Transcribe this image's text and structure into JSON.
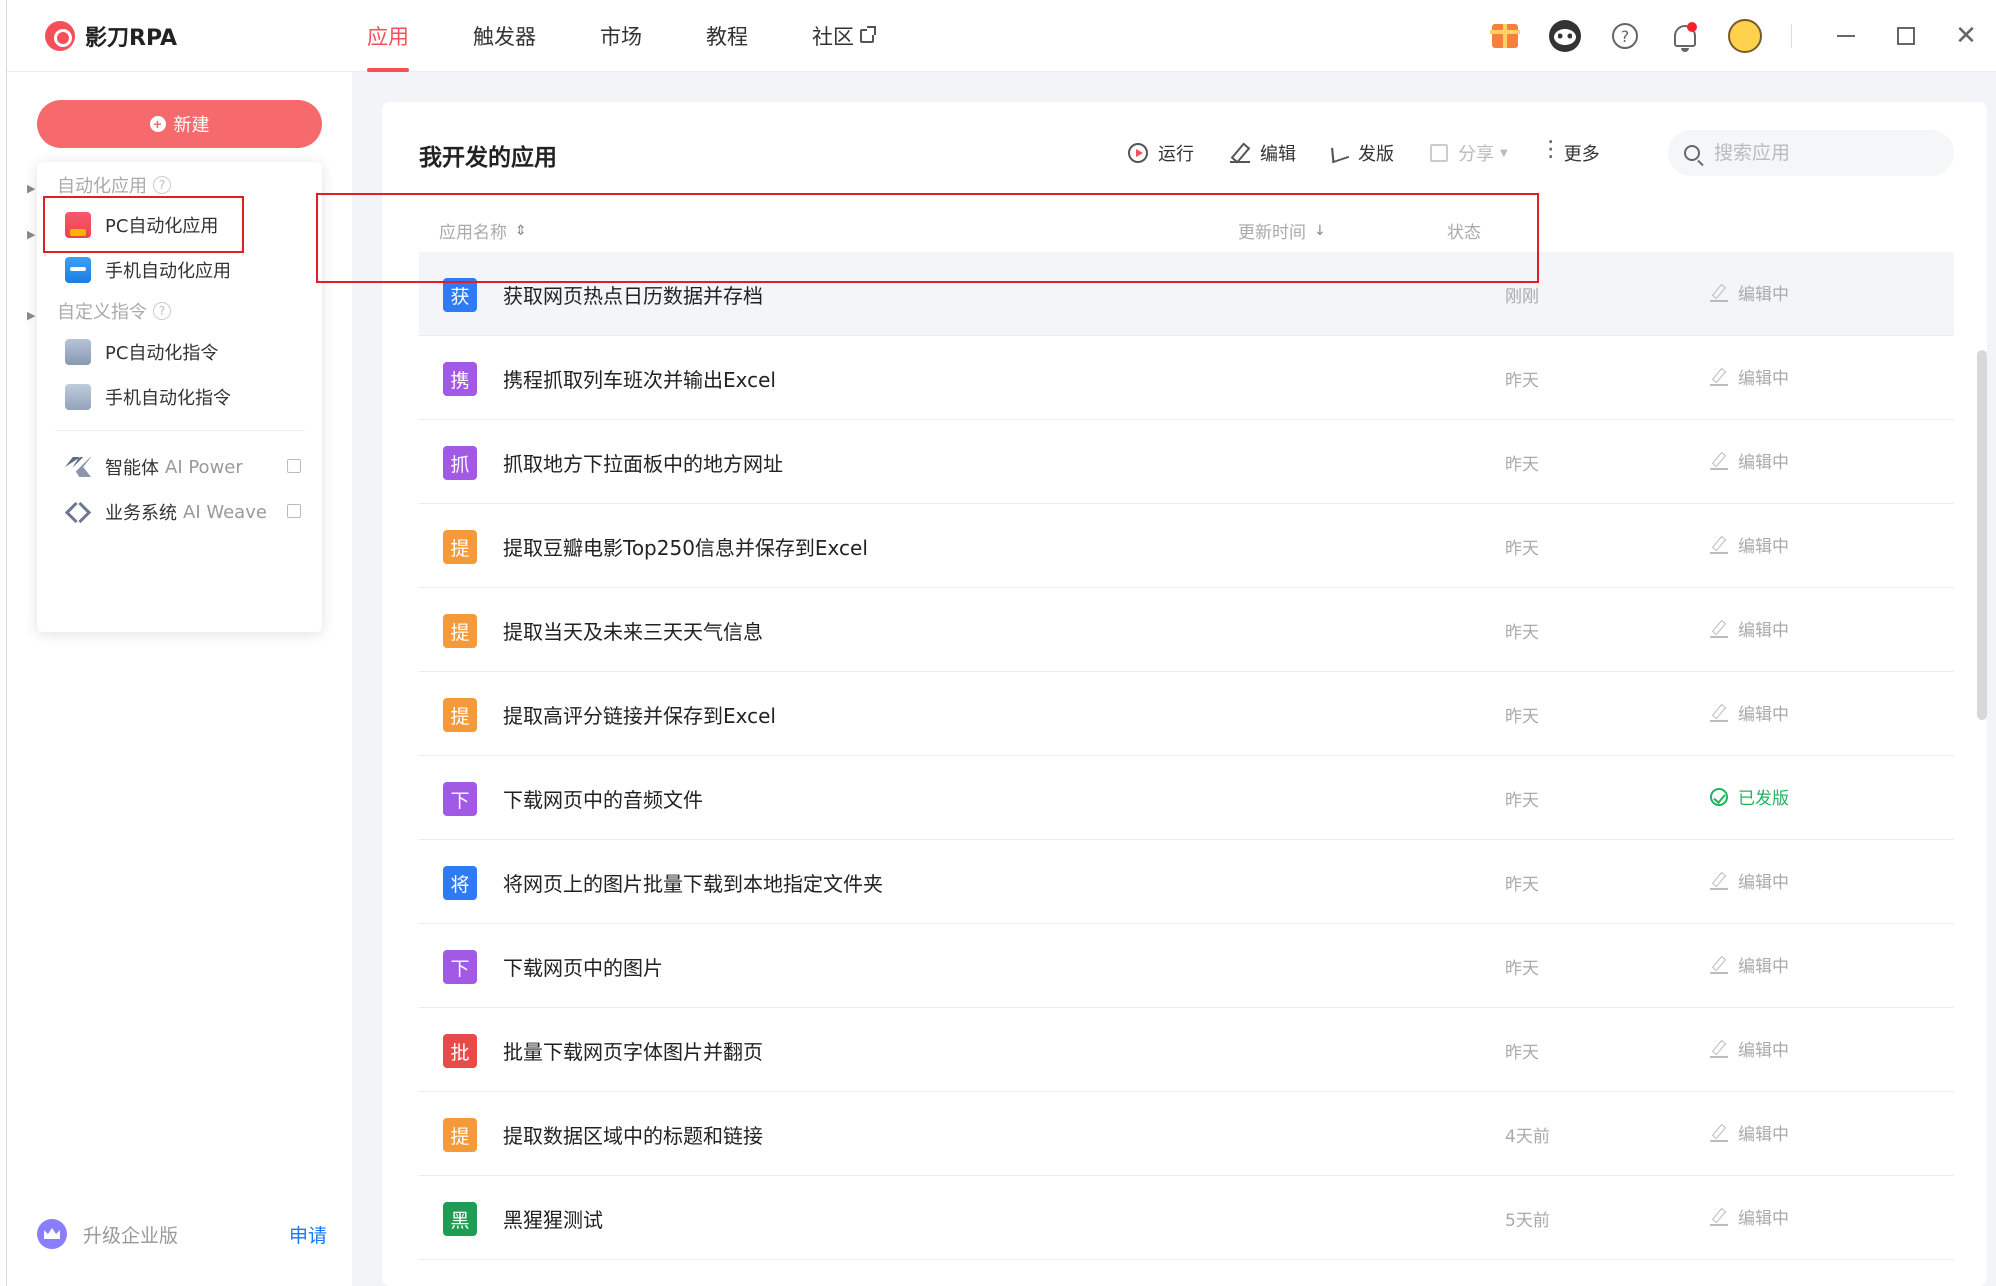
{
  "app": {
    "name": "影刀RPA"
  },
  "nav": [
    {
      "label": "应用",
      "active": true
    },
    {
      "label": "触发器"
    },
    {
      "label": "市场"
    },
    {
      "label": "教程"
    },
    {
      "label": "社区",
      "external": true
    }
  ],
  "sidebar": {
    "new_button": "新建",
    "section_auto_apps": "自动化应用",
    "section_custom_instr": "自定义指令",
    "items": [
      {
        "label": "PC自动化应用",
        "icon": "pc-app-icon"
      },
      {
        "label": "手机自动化应用",
        "icon": "mobile-app-icon"
      },
      {
        "label": "PC自动化指令",
        "icon": "pc-instruction-icon"
      },
      {
        "label": "手机自动化指令",
        "icon": "mobile-instruction-icon"
      },
      {
        "label": "智能体",
        "sub": "AI Power",
        "icon": "agent-icon"
      },
      {
        "label": "业务系统",
        "sub": "AI Weave",
        "icon": "weave-icon"
      }
    ],
    "upgrade": {
      "label": "升级企业版",
      "link": "申请"
    }
  },
  "main": {
    "title": "我开发的应用",
    "actions": {
      "run": "运行",
      "edit": "编辑",
      "publish": "发版",
      "share": "分享",
      "more": "更多"
    },
    "search_placeholder": "搜索应用",
    "columns": {
      "name": "应用名称",
      "updated": "更新时间",
      "status": "状态"
    },
    "rows": [
      {
        "badge": "获",
        "color": "#2f7bf5",
        "name": "获取网页热点日历数据并存档",
        "time": "刚刚",
        "status": "编辑中",
        "published": false,
        "selected": true
      },
      {
        "badge": "携",
        "color": "#a259e6",
        "name": "携程抓取列车班次并输出Excel",
        "time": "昨天",
        "status": "编辑中",
        "published": false
      },
      {
        "badge": "抓",
        "color": "#a259e6",
        "name": "抓取地方下拉面板中的地方网址",
        "time": "昨天",
        "status": "编辑中",
        "published": false
      },
      {
        "badge": "提",
        "color": "#f59a3a",
        "name": "提取豆瓣电影Top250信息并保存到Excel",
        "time": "昨天",
        "status": "编辑中",
        "published": false
      },
      {
        "badge": "提",
        "color": "#f59a3a",
        "name": "提取当天及未来三天天气信息",
        "time": "昨天",
        "status": "编辑中",
        "published": false
      },
      {
        "badge": "提",
        "color": "#f59a3a",
        "name": "提取高评分链接并保存到Excel",
        "time": "昨天",
        "status": "编辑中",
        "published": false
      },
      {
        "badge": "下",
        "color": "#a259e6",
        "name": "下载网页中的音频文件",
        "time": "昨天",
        "status": "已发版",
        "published": true
      },
      {
        "badge": "将",
        "color": "#2f7bf5",
        "name": "将网页上的图片批量下载到本地指定文件夹",
        "time": "昨天",
        "status": "编辑中",
        "published": false
      },
      {
        "badge": "下",
        "color": "#a259e6",
        "name": "下载网页中的图片",
        "time": "昨天",
        "status": "编辑中",
        "published": false
      },
      {
        "badge": "批",
        "color": "#e84a4a",
        "name": "批量下载网页字体图片并翻页",
        "time": "昨天",
        "status": "编辑中",
        "published": false
      },
      {
        "badge": "提",
        "color": "#f59a3a",
        "name": "提取数据区域中的标题和链接",
        "time": "4天前",
        "status": "编辑中",
        "published": false
      },
      {
        "badge": "黑",
        "color": "#1f9d55",
        "name": "黑猩猩测试",
        "time": "5天前",
        "status": "编辑中",
        "published": false
      }
    ]
  },
  "colors": {
    "accent": "#f5505a",
    "highlight": "#e02020",
    "link": "#1677ff",
    "published": "#22b35e"
  }
}
